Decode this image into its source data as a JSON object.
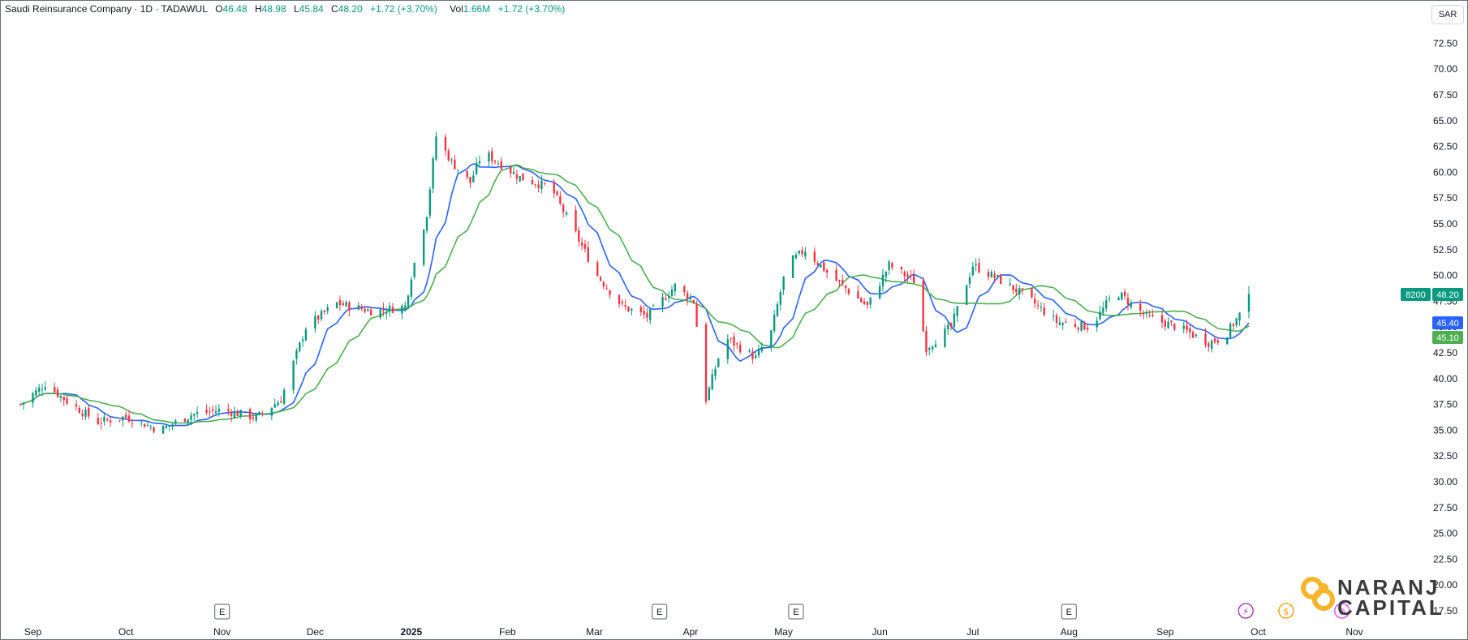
{
  "header": {
    "symbol": "Saudi Reinsurance Company · 1D · TADAWUL",
    "open_label": "O",
    "open": "46.48",
    "high_label": "H",
    "high": "48.98",
    "low_label": "L",
    "low": "45.84",
    "close_label": "C",
    "close": "48.20",
    "change": "+1.72 (+3.70%)",
    "volume_label": "Vol",
    "volume": "1.66M",
    "volume_change": "+1.72 (+3.70%)"
  },
  "currency": "SAR",
  "brand": {
    "line1": "NARANJ",
    "line2": "CAPITAL"
  },
  "colors": {
    "up": "#089981",
    "down": "#f23645",
    "ma_fast": "#2962ff",
    "ma_slow": "#4caf50",
    "axis_text": "#131722"
  },
  "chart_data": {
    "type": "candlestick",
    "ylim": [
      16,
      75
    ],
    "y_ticks": [
      17.5,
      20,
      22.5,
      25,
      27.5,
      30,
      32.5,
      35,
      37.5,
      40,
      42.5,
      45,
      47.5,
      50,
      52.5,
      55,
      57.5,
      60,
      62.5,
      65,
      67.5,
      70,
      72.5
    ],
    "x_labels": [
      {
        "label": "Sep",
        "date": "2024-09-01",
        "bold": false
      },
      {
        "label": "Oct",
        "date": "2024-10-01",
        "bold": false
      },
      {
        "label": "Nov",
        "date": "2024-11-01",
        "bold": false
      },
      {
        "label": "Dec",
        "date": "2024-12-01",
        "bold": false
      },
      {
        "label": "2025",
        "date": "2025-01-01",
        "bold": true
      },
      {
        "label": "Feb",
        "date": "2025-02-01",
        "bold": false
      },
      {
        "label": "Mar",
        "date": "2025-03-01",
        "bold": false
      },
      {
        "label": "Apr",
        "date": "2025-04-01",
        "bold": false
      },
      {
        "label": "May",
        "date": "2025-05-01",
        "bold": false
      },
      {
        "label": "Jun",
        "date": "2025-06-01",
        "bold": false
      },
      {
        "label": "Jul",
        "date": "2025-07-01",
        "bold": false
      },
      {
        "label": "Aug",
        "date": "2025-08-01",
        "bold": false
      },
      {
        "label": "Sep",
        "date": "2025-09-01",
        "bold": false
      },
      {
        "label": "Oct",
        "date": "2025-10-01",
        "bold": false
      },
      {
        "label": "Nov",
        "date": "2025-11-01",
        "bold": false
      }
    ],
    "price_path": [
      [
        "2024-08-28",
        37.5
      ],
      [
        "2024-09-05",
        39.5
      ],
      [
        "2024-09-12",
        37.8
      ],
      [
        "2024-09-22",
        35.8
      ],
      [
        "2024-10-01",
        36.3
      ],
      [
        "2024-10-12",
        35.0
      ],
      [
        "2024-10-22",
        36.5
      ],
      [
        "2024-11-01",
        37.0
      ],
      [
        "2024-11-12",
        36.2
      ],
      [
        "2024-11-20",
        38.0
      ],
      [
        "2024-11-28",
        45.0
      ],
      [
        "2024-12-08",
        47.3
      ],
      [
        "2024-12-20",
        46.5
      ],
      [
        "2024-12-30",
        47.0
      ],
      [
        "2025-01-01",
        50.0
      ],
      [
        "2025-01-06",
        56.0
      ],
      [
        "2025-01-09",
        63.5
      ],
      [
        "2025-01-14",
        61.0
      ],
      [
        "2025-01-20",
        59.0
      ],
      [
        "2025-01-24",
        62.0
      ],
      [
        "2025-02-05",
        59.5
      ],
      [
        "2025-02-15",
        58.5
      ],
      [
        "2025-02-23",
        54.0
      ],
      [
        "2025-03-02",
        50.0
      ],
      [
        "2025-03-10",
        47.0
      ],
      [
        "2025-03-18",
        46.0
      ],
      [
        "2025-03-27",
        49.0
      ],
      [
        "2025-04-02",
        47.5
      ],
      [
        "2025-04-06",
        38.0
      ],
      [
        "2025-04-12",
        44.0
      ],
      [
        "2025-04-22",
        42.0
      ],
      [
        "2025-04-27",
        44.5
      ],
      [
        "2025-05-02",
        51.0
      ],
      [
        "2025-05-08",
        52.5
      ],
      [
        "2025-05-16",
        50.0
      ],
      [
        "2025-05-28",
        47.0
      ],
      [
        "2025-06-04",
        51.0
      ],
      [
        "2025-06-12",
        49.5
      ],
      [
        "2025-06-16",
        43.0
      ],
      [
        "2025-06-24",
        45.0
      ],
      [
        "2025-07-01",
        51.0
      ],
      [
        "2025-07-10",
        49.5
      ],
      [
        "2025-07-18",
        48.0
      ],
      [
        "2025-07-28",
        45.5
      ],
      [
        "2025-08-08",
        45.0
      ],
      [
        "2025-08-16",
        48.5
      ],
      [
        "2025-08-26",
        46.0
      ],
      [
        "2025-09-05",
        45.0
      ],
      [
        "2025-09-15",
        43.5
      ],
      [
        "2025-09-20",
        44.0
      ],
      [
        "2025-09-25",
        46.2
      ],
      [
        "2025-09-28",
        48.2
      ]
    ],
    "series": [
      {
        "name": "",
        "type": "ma",
        "color": "#2962ff",
        "last": 45.4
      },
      {
        "name": "",
        "type": "ma",
        "color": "#4caf50",
        "last": 45.1
      }
    ],
    "price_labels": [
      {
        "text": "48.20",
        "value": 48.2,
        "color": "#089981"
      },
      {
        "text": "45.40",
        "value": 45.4,
        "color": "#2962ff"
      },
      {
        "text": "45.10",
        "value": 45.1,
        "color": "#4caf50"
      }
    ],
    "countdown": "8200",
    "event_markers": [
      {
        "text": "E",
        "date": "2024-11-01"
      },
      {
        "text": "E",
        "date": "2025-03-22"
      },
      {
        "text": "E",
        "date": "2025-05-05"
      },
      {
        "text": "E",
        "date": "2025-08-01"
      }
    ],
    "circle_markers": [
      {
        "text": "⚡",
        "date": "2025-09-27",
        "color": "#9c27b0"
      },
      {
        "text": "$",
        "date": "2025-10-10",
        "color": "#ff9800"
      },
      {
        "text": "⊘",
        "date": "2025-10-28",
        "color": "#e040fb"
      }
    ]
  }
}
